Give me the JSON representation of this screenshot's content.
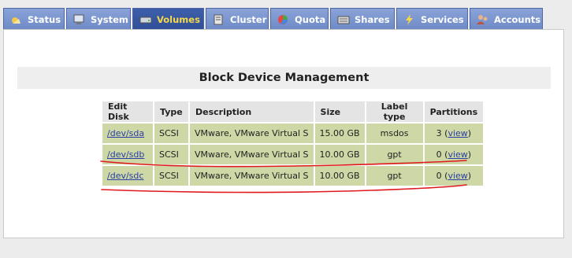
{
  "tabs": [
    {
      "label": "Status",
      "icon": "status-icon",
      "active": false
    },
    {
      "label": "System",
      "icon": "system-icon",
      "active": false
    },
    {
      "label": "Volumes",
      "icon": "volumes-icon",
      "active": true
    },
    {
      "label": "Cluster",
      "icon": "cluster-icon",
      "active": false
    },
    {
      "label": "Quota",
      "icon": "quota-icon",
      "active": false
    },
    {
      "label": "Shares",
      "icon": "shares-icon",
      "active": false
    },
    {
      "label": "Services",
      "icon": "services-icon",
      "active": false
    },
    {
      "label": "Accounts",
      "icon": "accounts-icon",
      "active": false
    }
  ],
  "main": {
    "title": "Block Device Management",
    "columns": [
      "Edit Disk",
      "Type",
      "Description",
      "Size",
      "Label type",
      "Partitions"
    ],
    "rows": [
      {
        "disk": "/dev/sda",
        "type": "SCSI",
        "description": "VMware, VMware Virtual S",
        "size": "15.00 GB",
        "label_type": "msdos",
        "partitions": "3",
        "view": "view"
      },
      {
        "disk": "/dev/sdb",
        "type": "SCSI",
        "description": "VMware, VMware Virtual S",
        "size": "10.00 GB",
        "label_type": "gpt",
        "partitions": "0",
        "view": "view"
      },
      {
        "disk": "/dev/sdc",
        "type": "SCSI",
        "description": "VMware, VMware Virtual S",
        "size": "10.00 GB",
        "label_type": "gpt",
        "partitions": "0",
        "view": "view"
      }
    ]
  },
  "colors": {
    "tab": "#7a93cf",
    "tab_active": "#3a5aa6",
    "tab_active_text": "#f6d84a",
    "row_bg": "#cdd8a6",
    "header_bg": "#e4e4e4",
    "annotation": "#e0191e"
  }
}
